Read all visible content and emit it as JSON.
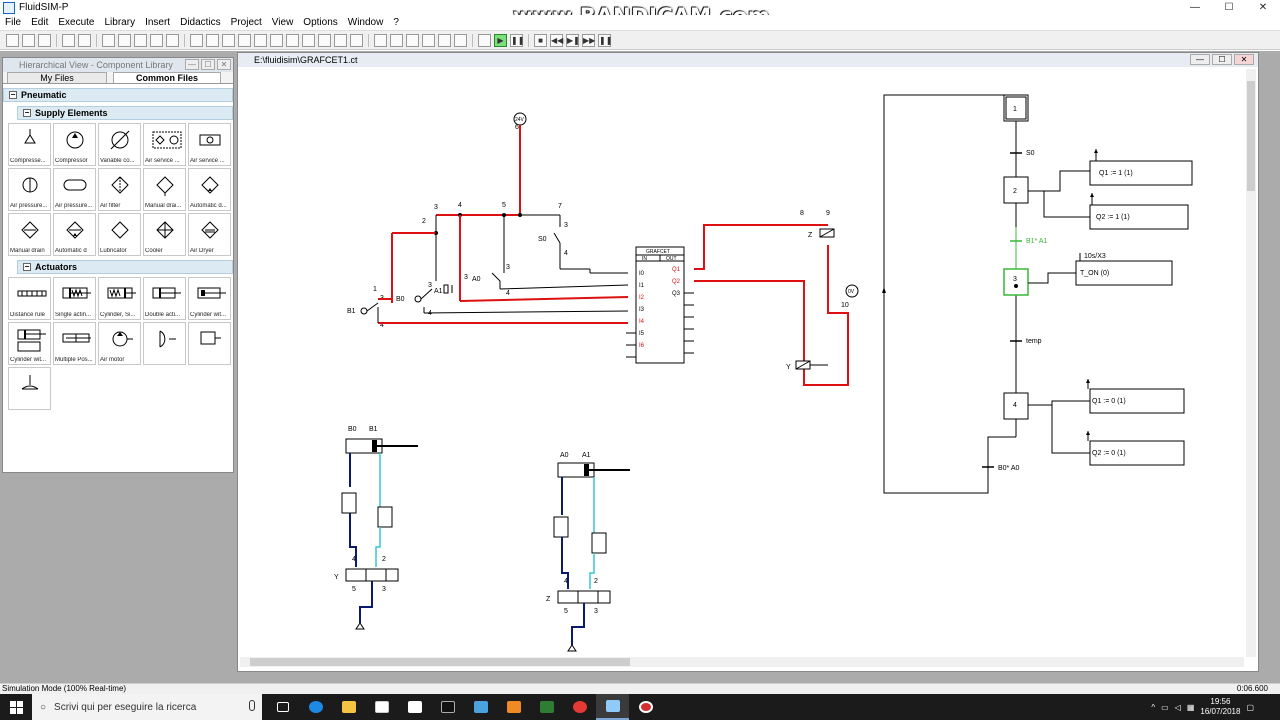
{
  "app": {
    "title": "FluidSIM-P"
  },
  "watermark": "www.BANDICAM.com",
  "menu": [
    "File",
    "Edit",
    "Execute",
    "Library",
    "Insert",
    "Didactics",
    "Project",
    "View",
    "Options",
    "Window",
    "?"
  ],
  "library": {
    "window_title": "Hierarchical View - Component Library",
    "tabs": [
      "My Files",
      "Common Files"
    ],
    "category_pneumatic": "Pneumatic",
    "supply_title": "Supply Elements",
    "supply_items": [
      "Compresse...",
      "Compressor",
      "Variable co...",
      "Air service ...",
      "Air service ...",
      "Air pressure...",
      "Air pressure...",
      "Air filter",
      "Manual drai...",
      "Automatic d...",
      "Manual drain",
      "Automatic d",
      "Lubricator",
      "Cooler",
      "Air Dryer"
    ],
    "actuators_title": "Actuators",
    "actuator_items": [
      "Distance rule",
      "Single actin...",
      "Cylinder, Si...",
      "Double acti...",
      "Cylinder wit...",
      "Cylinder wit...",
      "Multiple Pos...",
      "Air motor",
      "",
      ""
    ]
  },
  "canvas": {
    "window_title": "E:\\fluidisim\\GRAFCET1.ct",
    "grafcet_block": {
      "title": "GRAFCET",
      "in": "IN",
      "out": "OUT",
      "inputs": [
        "I0",
        "I1",
        "I2",
        "I3",
        "I4",
        "I5",
        "I6"
      ],
      "outputs": [
        "Q1",
        "Q2",
        "Q3"
      ]
    },
    "labels": {
      "v24": "24V",
      "v0": "0V",
      "b1": "B1",
      "b0": "B0",
      "a1": "A1",
      "a0": "A0",
      "s0": "S0",
      "z": "Z",
      "y": "Y",
      "n1": "1",
      "n2": "2",
      "n3": "3",
      "n4": "4",
      "n5": "5",
      "n6": "6",
      "n7": "7",
      "n8": "8",
      "n9": "9",
      "n10": "10"
    },
    "sfc": {
      "steps": [
        "1",
        "2",
        "3",
        "4"
      ],
      "transitions": [
        "S0",
        "B1* A1",
        "temp",
        "B0* A0"
      ],
      "actions": [
        "Q1 := 1 (1)",
        "Q2 := 1 (1)",
        "T_ON (0)",
        "Q1 := 0 (1)",
        "Q2 := 0 (1)"
      ],
      "timer_note": "10s/X3"
    }
  },
  "status": {
    "left": "Simulation Mode (100% Real-time)",
    "right": "0:06.600"
  },
  "taskbar": {
    "search_placeholder": "Scrivi qui per eseguire la ricerca",
    "time": "19:56",
    "date": "16/07/2018"
  },
  "colors": {
    "active_wire": "#dd1111",
    "pneumatic_supply": "#0b1a6e",
    "pneumatic_exhaust": "#35c9d6",
    "active_step": "#38b838"
  }
}
